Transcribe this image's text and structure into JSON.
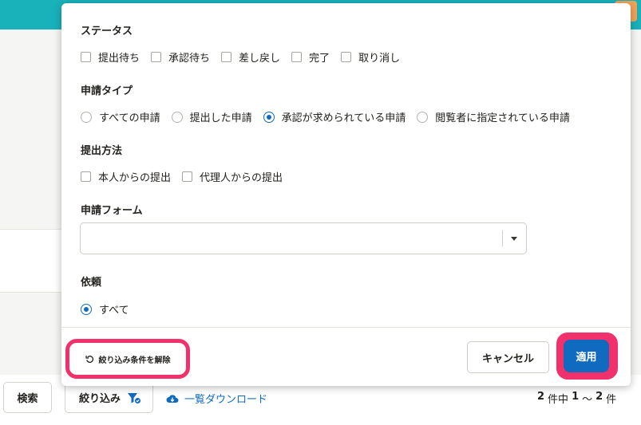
{
  "background": {
    "search_label": "検索",
    "filter_label": "絞り込み",
    "download_label": "一覧ダウンロード",
    "count": {
      "total": "2",
      "unit1": "件中",
      "from": "1",
      "tilde": "〜",
      "to": "2",
      "unit2": "件"
    }
  },
  "dialog": {
    "status": {
      "title": "ステータス",
      "options": [
        {
          "label": "提出待ち",
          "checked": false
        },
        {
          "label": "承認待ち",
          "checked": false
        },
        {
          "label": "差し戻し",
          "checked": false
        },
        {
          "label": "完了",
          "checked": false
        },
        {
          "label": "取り消し",
          "checked": false
        }
      ]
    },
    "request_type": {
      "title": "申請タイプ",
      "options": [
        {
          "label": "すべての申請",
          "selected": false
        },
        {
          "label": "提出した申請",
          "selected": false
        },
        {
          "label": "承認が求められている申請",
          "selected": true
        },
        {
          "label": "閲覧者に指定されている申請",
          "selected": false
        }
      ]
    },
    "submission_method": {
      "title": "提出方法",
      "options": [
        {
          "label": "本人からの提出",
          "checked": false
        },
        {
          "label": "代理人からの提出",
          "checked": false
        }
      ]
    },
    "request_form": {
      "title": "申請フォーム",
      "value": ""
    },
    "request": {
      "title": "依頼",
      "options": [
        {
          "label": "すべて",
          "selected": true
        }
      ]
    },
    "footer": {
      "clear_label": "絞り込み条件を解除",
      "cancel_label": "キャンセル",
      "apply_label": "適用"
    }
  },
  "colors": {
    "accent": "#0f6ac0",
    "highlight": "#f0316b",
    "topbar": "#19b1ba"
  }
}
